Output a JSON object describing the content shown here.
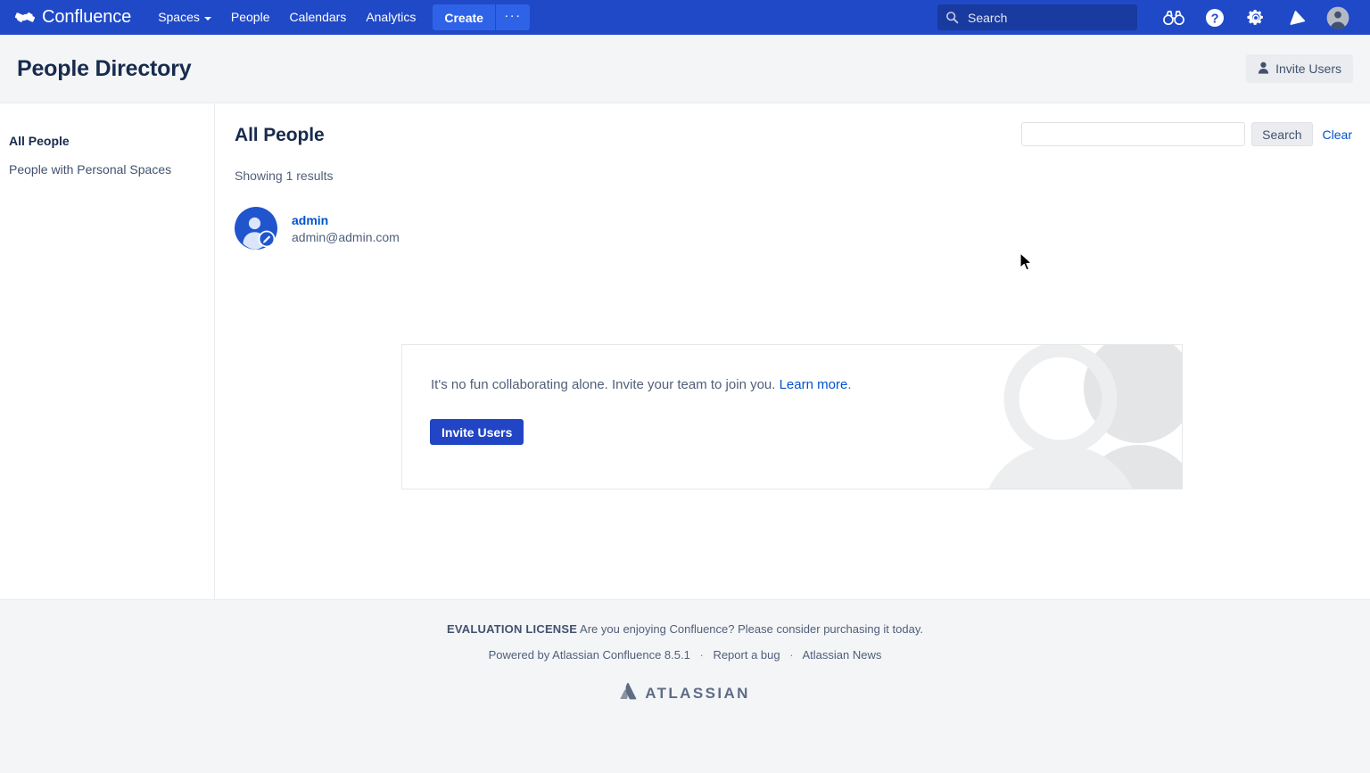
{
  "nav": {
    "brand": "Confluence",
    "brand_icon": "confluence-logo-icon",
    "links": [
      {
        "label": "Spaces",
        "has_caret": true
      },
      {
        "label": "People",
        "has_caret": false
      },
      {
        "label": "Calendars",
        "has_caret": false
      },
      {
        "label": "Analytics",
        "has_caret": false
      }
    ],
    "create_label": "Create",
    "create_more_label": "···",
    "search_placeholder": "Search",
    "search_value": "",
    "icons": [
      "binoculars-icon",
      "help-icon",
      "settings-gear-icon",
      "notifications-bell-icon",
      "user-avatar-icon"
    ]
  },
  "header": {
    "title": "People Directory",
    "invite_users_label": "Invite Users"
  },
  "sidebar": {
    "items": [
      {
        "label": "All People",
        "active": true
      },
      {
        "label": "People with Personal Spaces",
        "active": false
      }
    ]
  },
  "main": {
    "title": "All People",
    "results_text": "Showing 1 results",
    "search": {
      "value": "",
      "placeholder": "",
      "search_label": "Search",
      "clear_label": "Clear"
    },
    "people": [
      {
        "name": "admin",
        "email": "admin@admin.com"
      }
    ],
    "invite_card": {
      "message_before": "It's no fun collaborating alone. Invite your team to join you. ",
      "link_label": "Learn more",
      "message_after": ".",
      "button_label": "Invite Users"
    }
  },
  "footer": {
    "license_label": "EVALUATION LICENSE",
    "license_text": " Are you enjoying Confluence? Please consider purchasing it today.",
    "powered_by": "Powered by Atlassian Confluence 8.5.1",
    "report_bug": "Report a bug",
    "atlassian_news": "Atlassian News",
    "separator": "·",
    "logo_text": "ATLASSIAN"
  },
  "colors": {
    "nav_bg": "#2049C7",
    "create_blue": "#2E63E8",
    "link_blue": "#0052CC",
    "primary_button": "#2145C4",
    "page_header_bg": "#F4F5F7",
    "text_dark": "#172B4D",
    "text_muted": "#505F79"
  }
}
